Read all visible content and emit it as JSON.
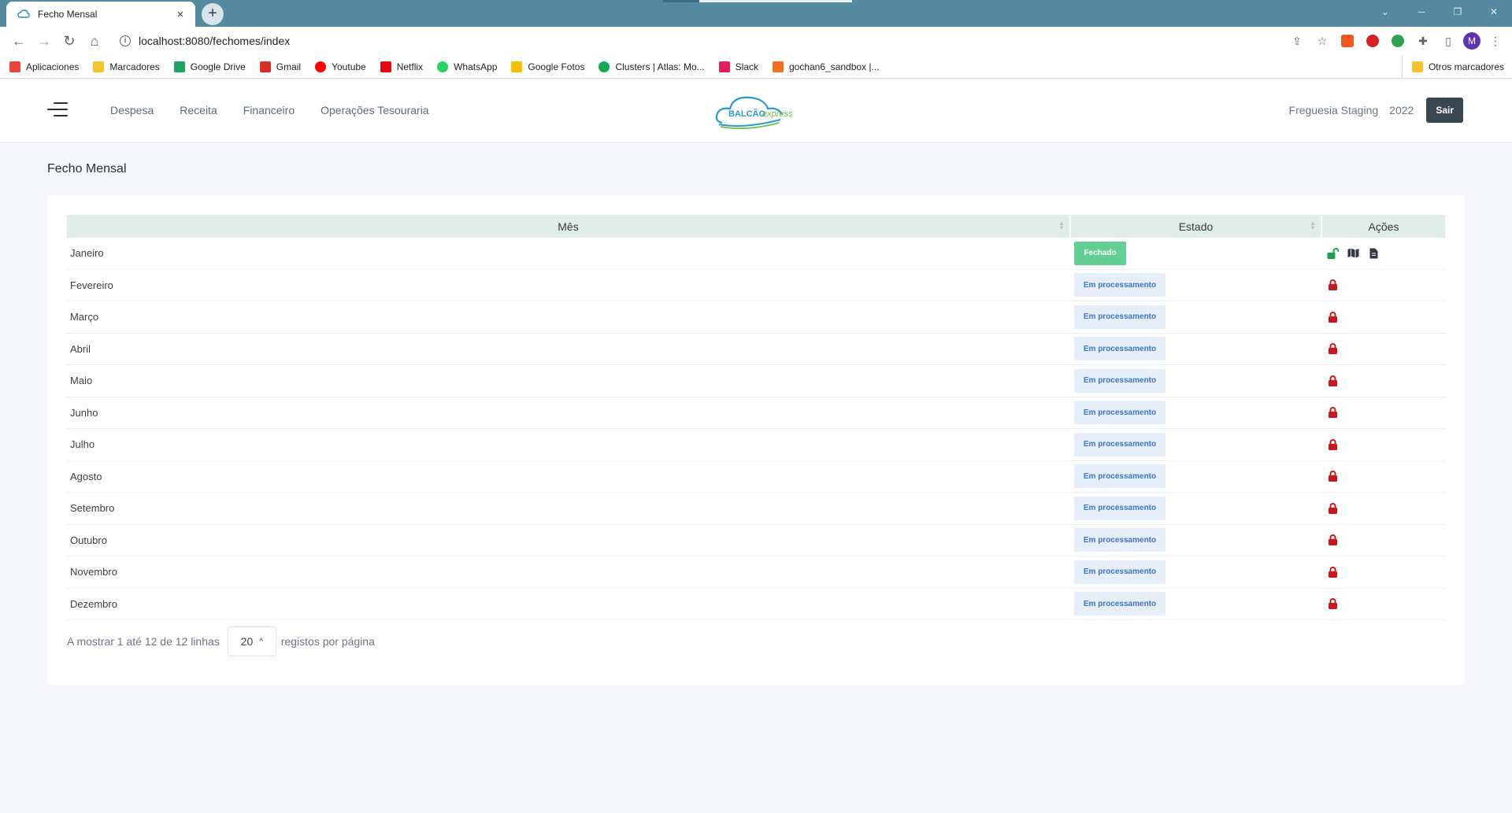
{
  "browser": {
    "tab_title": "Fecho Mensal",
    "tab_close": "×",
    "new_tab": "+",
    "url": "localhost:8080/fechomes/index",
    "profile_initial": "M",
    "bookmarks": [
      {
        "label": "Aplicaciones",
        "icon": "apps-grid-icon",
        "color": "#e8453c"
      },
      {
        "label": "Marcadores",
        "icon": "folder-icon",
        "color": "#f4c430"
      },
      {
        "label": "Google Drive",
        "icon": "google-drive-icon",
        "color": "#1fa463"
      },
      {
        "label": "Gmail",
        "icon": "gmail-icon",
        "color": "#d93025"
      },
      {
        "label": "Youtube",
        "icon": "youtube-icon",
        "color": "#ff0000"
      },
      {
        "label": "Netflix",
        "icon": "netflix-icon",
        "color": "#e50914"
      },
      {
        "label": "WhatsApp",
        "icon": "whatsapp-icon",
        "color": "#25d366"
      },
      {
        "label": "Google Fotos",
        "icon": "google-photos-icon",
        "color": "#fbbc04"
      },
      {
        "label": "Clusters | Atlas: Mo...",
        "icon": "mongodb-leaf-icon",
        "color": "#13aa52"
      },
      {
        "label": "Slack",
        "icon": "slack-icon",
        "color": "#e01e5a"
      },
      {
        "label": "gochan6_sandbox |...",
        "icon": "sandbox-icon",
        "color": "#f37021"
      }
    ],
    "other_bookmarks": "Otros marcadores"
  },
  "header": {
    "nav": [
      "Despesa",
      "Receita",
      "Financeiro",
      "Operações Tesouraria"
    ],
    "logo_text": "BALCÃO",
    "logo_suffix": "express",
    "entity": "Freguesia Staging",
    "year": "2022",
    "logout_label": "Sair"
  },
  "page": {
    "title": "Fecho Mensal"
  },
  "table": {
    "columns": [
      "Mês",
      "Estado",
      "Ações"
    ],
    "rows": [
      {
        "month": "Janeiro",
        "status": "Fechado",
        "state": "closed"
      },
      {
        "month": "Fevereiro",
        "status": "Em processamento",
        "state": "processing"
      },
      {
        "month": "Março",
        "status": "Em processamento",
        "state": "processing"
      },
      {
        "month": "Abril",
        "status": "Em processamento",
        "state": "processing"
      },
      {
        "month": "Maio",
        "status": "Em processamento",
        "state": "processing"
      },
      {
        "month": "Junho",
        "status": "Em processamento",
        "state": "processing"
      },
      {
        "month": "Julho",
        "status": "Em processamento",
        "state": "processing"
      },
      {
        "month": "Agosto",
        "status": "Em processamento",
        "state": "processing"
      },
      {
        "month": "Setembro",
        "status": "Em processamento",
        "state": "processing"
      },
      {
        "month": "Outubro",
        "status": "Em processamento",
        "state": "processing"
      },
      {
        "month": "Novembro",
        "status": "Em processamento",
        "state": "processing"
      },
      {
        "month": "Dezembro",
        "status": "Em processamento",
        "state": "processing"
      }
    ]
  },
  "footer": {
    "showing": "A mostrar 1 até 12 de 12 linhas",
    "page_size": "20",
    "per_page": "registos por página"
  },
  "colors": {
    "closed_badge": "#63cf94",
    "processing_badge_bg": "#e6eef9",
    "processing_badge_text": "#3d74c6",
    "lock_red": "#c9171e",
    "unlock_green": "#1aa34a",
    "header_row": "#e0eee8",
    "tabstrip": "#558aa0"
  }
}
